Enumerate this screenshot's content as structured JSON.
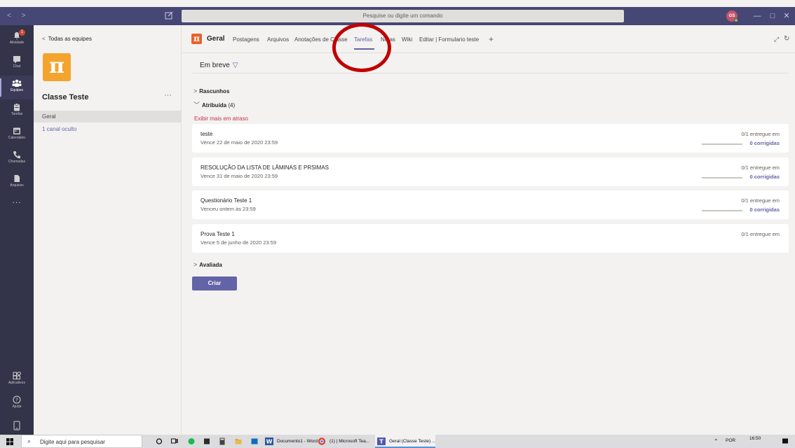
{
  "titlebar": {
    "search_placeholder": "Pesquise ou digite um comando",
    "avatar_initials": "GS",
    "nav_glyphs": "< >"
  },
  "rail": {
    "activity_badge": "1",
    "items": [
      {
        "label": "Atividade",
        "icon": "bell-icon"
      },
      {
        "label": "Chat",
        "icon": "chat-icon"
      },
      {
        "label": "Equipes",
        "icon": "teams-icon"
      },
      {
        "label": "Tarefas",
        "icon": "assignments-icon"
      },
      {
        "label": "Calendário",
        "icon": "calendar-icon"
      },
      {
        "label": "Chamadas",
        "icon": "phone-icon"
      },
      {
        "label": "Arquivos",
        "icon": "file-icon"
      },
      {
        "label": "...",
        "icon": "more-icon"
      },
      {
        "label": "Aplicativos",
        "icon": "apps-icon"
      },
      {
        "label": "Ajuda",
        "icon": "help-icon"
      }
    ]
  },
  "team": {
    "back_label": "Todas as equipes",
    "logo_glyph": "π",
    "name": "Classe Teste",
    "more": "···",
    "channel": "Geral",
    "hidden_channels": "1 canal oculto"
  },
  "channel": {
    "logo_glyph": "π",
    "title": "Geral",
    "tabs": [
      {
        "label": "Postagens",
        "active": false
      },
      {
        "label": "Arquivos",
        "active": false
      },
      {
        "label": "Anotações de Classe",
        "active": false
      },
      {
        "label": "Tarefas",
        "active": true
      },
      {
        "label": "Notas",
        "active": false
      },
      {
        "label": "Wiki",
        "active": false
      },
      {
        "label": "Editar | Formulario teste",
        "active": false
      }
    ],
    "add_tab": "+"
  },
  "assignments": {
    "filter_label": "Em breve",
    "drafts_label": "Rascunhos",
    "assigned_label": "Atribuída",
    "assigned_count": "(4)",
    "late_link": "Exibir mais em atraso",
    "items": [
      {
        "title": "teste",
        "due": "Vence 22 de maio de 2020 23:59",
        "handed": "0/1 entregue em",
        "graded": "0 corrigidas",
        "progress": 0
      },
      {
        "title": "RESOLUÇÃO DA LISTA DE LÂMINAS E PRSIMAS",
        "due": "Vence 31 de maio de 2020 23:59",
        "handed": "0/1 entregue em",
        "graded": "0 corrigidas",
        "progress": 0
      },
      {
        "title": "Questionário Teste 1",
        "due": "Venceu ontem às 23:59",
        "handed": "0/1 entregue em",
        "graded": "0 corrigidas",
        "progress": 0
      },
      {
        "title": "Prova Teste 1",
        "due": "Vence 5 de junho de 2020 23:59",
        "handed": "0/1 entregue em",
        "graded": "",
        "progress": 0
      }
    ],
    "graded_section": "Avaliada",
    "create_button": "Criar"
  },
  "taskbar": {
    "search_placeholder": "Digite aqui para pesquisar",
    "apps": [
      {
        "label": "Documento1 - Word",
        "icon": "word-icon"
      },
      {
        "label": "(1) | Microsoft Tea...",
        "icon": "chrome-icon"
      },
      {
        "label": "Geral (Classe Teste) ...",
        "icon": "teams-icon"
      }
    ],
    "language": "POR",
    "time": "16:50"
  },
  "colors": {
    "accent": "#6264a7",
    "titlebar": "#464775",
    "rail": "#33344a",
    "late": "#c4314b",
    "annotation": "#c00000"
  }
}
